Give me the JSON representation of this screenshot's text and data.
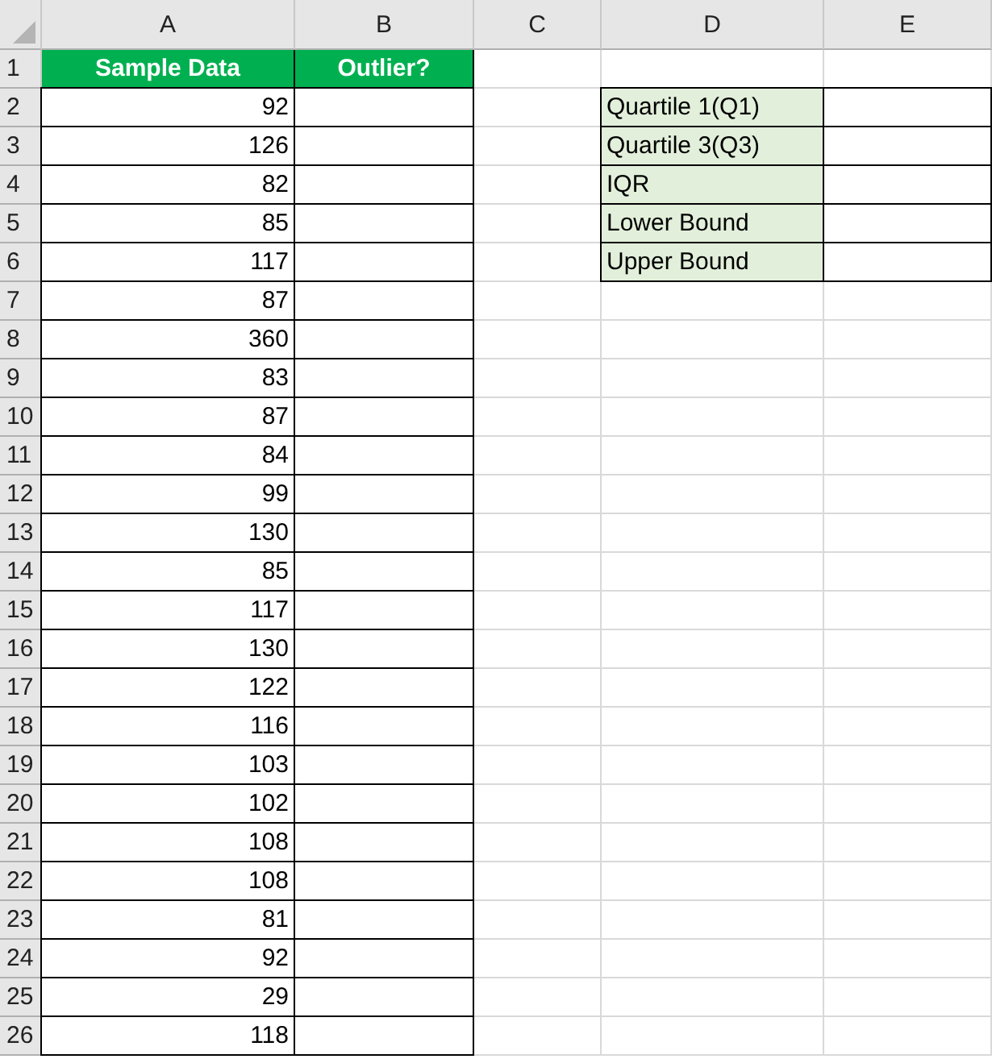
{
  "column_headers": [
    "A",
    "B",
    "C",
    "D",
    "E"
  ],
  "row_headers": [
    "1",
    "2",
    "3",
    "4",
    "5",
    "6",
    "7",
    "8",
    "9",
    "10",
    "11",
    "12",
    "13",
    "14",
    "15",
    "16",
    "17",
    "18",
    "19",
    "20",
    "21",
    "22",
    "23",
    "24",
    "25",
    "26"
  ],
  "sample_table": {
    "headers": [
      "Sample Data",
      "Outlier?"
    ],
    "values": [
      "92",
      "126",
      "82",
      "85",
      "117",
      "87",
      "360",
      "83",
      "87",
      "84",
      "99",
      "130",
      "85",
      "117",
      "130",
      "122",
      "116",
      "103",
      "102",
      "108",
      "108",
      "81",
      "92",
      "29",
      "118"
    ]
  },
  "stats_table": {
    "labels": [
      "Quartile 1(Q1)",
      "Quartile 3(Q3)",
      "IQR",
      "Lower Bound",
      "Upper Bound"
    ]
  }
}
